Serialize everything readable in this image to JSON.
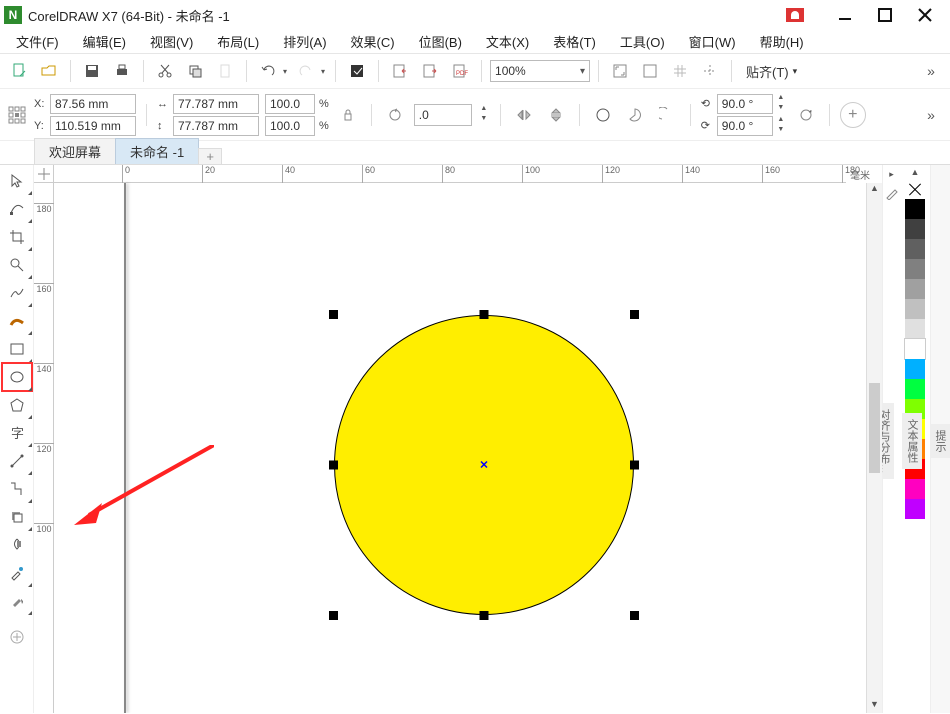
{
  "app": {
    "title": "CorelDRAW X7 (64-Bit) - 未命名 -1"
  },
  "menus": {
    "file": "文件(F)",
    "edit": "编辑(E)",
    "view": "视图(V)",
    "layout": "布局(L)",
    "arrange": "排列(A)",
    "effects": "效果(C)",
    "bitmap": "位图(B)",
    "text": "文本(X)",
    "table": "表格(T)",
    "tools": "工具(O)",
    "window": "窗口(W)",
    "help": "帮助(H)"
  },
  "toolbar": {
    "zoom": "100%",
    "paste": "贴齐(T)"
  },
  "props": {
    "x_label": "X:",
    "x": "87.56 mm",
    "y_label": "Y:",
    "y": "110.519 mm",
    "w": "77.787 mm",
    "h": "77.787 mm",
    "sx": "100.0",
    "sy": "100.0",
    "pct": "%",
    "rot": ".0",
    "ang1": "90.0 °",
    "ang2": "90.0 °"
  },
  "tabs": {
    "welcome": "欢迎屏幕",
    "doc": "未命名 -1"
  },
  "ruler": {
    "unit": "毫米",
    "h": [
      "0",
      "20",
      "40",
      "60",
      "80",
      "100",
      "120",
      "140",
      "160",
      "180"
    ],
    "v": [
      "180",
      "160",
      "140",
      "120",
      "100"
    ]
  },
  "dockers": {
    "hints": "提示",
    "textprops": "文本属性",
    "align": "对齐与分布..."
  },
  "palette": [
    "#000000",
    "#404040",
    "#606060",
    "#808080",
    "#a0a0a0",
    "#c0c0c0",
    "#e0e0e0",
    "#ffffff",
    "#00b0ff",
    "#00ff40",
    "#7fff00",
    "#ffff00",
    "#ff8000",
    "#ff0000",
    "#ff00c0",
    "#c000ff"
  ]
}
